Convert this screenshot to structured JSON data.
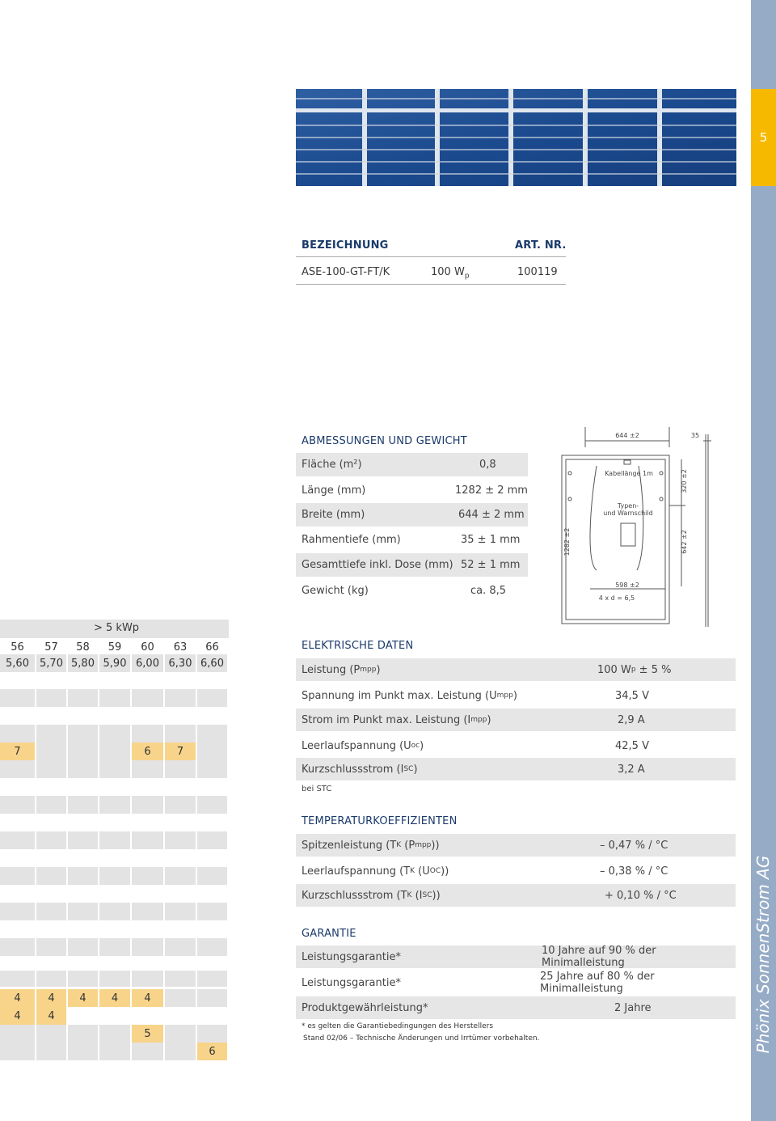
{
  "designation": {
    "header_label": "BEZEICHNUNG",
    "art_nr_label": "ART. NR.",
    "model": "ASE-100-GT-FT/K",
    "power_main": "100 W",
    "power_sub": "p",
    "art_nr": "100119"
  },
  "dimensions": {
    "title": "ABMESSUNGEN UND GEWICHT",
    "rows": [
      {
        "label": "Fläche (m²)",
        "value": "0,8"
      },
      {
        "label": "Länge (mm)",
        "value": "1282 ± 2 mm"
      },
      {
        "label": "Breite (mm)",
        "value": "644 ± 2 mm"
      },
      {
        "label": "Rahmentiefe (mm)",
        "value": "35 ± 1 mm"
      },
      {
        "label": "Gesamttiefe inkl. Dose (mm)",
        "value": "52 ± 1 mm"
      },
      {
        "label": "Gewicht (kg)",
        "value": "ca. 8,5"
      }
    ]
  },
  "drawing": {
    "width_label": "644 ±2",
    "depth_label": "35",
    "cable_label": "Kabellänge 1m",
    "typen_line1": "Typen-",
    "typen_line2": "und Warnschild",
    "height_label": "1282 ±2",
    "right_upper_label": "320 ±2",
    "right_lower_label": "642 ±2",
    "inner_width_label": "598 ±2",
    "holes_label": "4 x d = 6,5"
  },
  "left_table": {
    "header": "> 5 kWp",
    "row1": [
      "56",
      "57",
      "58",
      "59",
      "60",
      "63",
      "66"
    ],
    "row2": [
      "5,60",
      "5,70",
      "5,80",
      "5,90",
      "6,00",
      "6,30",
      "6,60"
    ],
    "yellow_row_a": [
      "7",
      "",
      "",
      "",
      "6",
      "7",
      ""
    ],
    "row_4a": [
      "4",
      "4",
      "4",
      "4",
      "4",
      "",
      ""
    ],
    "row_4b": [
      "4",
      "4",
      "",
      "",
      "",
      "",
      ""
    ],
    "row_5": [
      "",
      "",
      "",
      "",
      "5",
      "",
      ""
    ],
    "row_6": [
      "",
      "",
      "",
      "",
      "",
      "",
      "6"
    ]
  },
  "electrical": {
    "title": "ELEKTRISCHE DATEN",
    "rows": [
      {
        "label": "Leistung (P",
        "sub": "mpp",
        "end": ")",
        "value": "100 W",
        "vsub": "p",
        "vend": " ± 5 %"
      },
      {
        "label": "Spannung im Punkt max. Leistung (U",
        "sub": "mpp",
        "end": ")",
        "value": "34,5 V",
        "vsub": "",
        "vend": ""
      },
      {
        "label": "Strom im Punkt max. Leistung (I",
        "sub": "mpp",
        "end": ")",
        "value": "2,9 A",
        "vsub": "",
        "vend": ""
      },
      {
        "label": "Leerlaufspannung (U",
        "sub": "oc",
        "end": ")",
        "value": "42,5 V",
        "vsub": "",
        "vend": ""
      },
      {
        "label": "Kurzschlussstrom (I",
        "sub": "SC",
        "end": ")",
        "value": "3,2 A",
        "vsub": "",
        "vend": ""
      }
    ],
    "note": "bei STC"
  },
  "temperature": {
    "title": "TEMPERATURKOEFFIZIENTEN",
    "rows": [
      {
        "label": "Spitzenleistung (T",
        "sub1": "K",
        "mid": " (P",
        "sub2": "mpp",
        "end": "))",
        "value": "– 0,47 % / °C"
      },
      {
        "label": "Leerlaufspannung (T",
        "sub1": "K",
        "mid": " (U",
        "sub2": "OC",
        "end": "))",
        "value": "– 0,38 % / °C"
      },
      {
        "label": "Kurzschlussstrom (T",
        "sub1": "K",
        "mid": " (I",
        "sub2": "SC",
        "end": "))",
        "value": "+ 0,10 % / °C"
      }
    ]
  },
  "warranty": {
    "title": "GARANTIE",
    "rows": [
      {
        "label": "Leistungsgarantie*",
        "value": "10 Jahre auf 90 % der Minimalleistung"
      },
      {
        "label": "Leistungsgarantie*",
        "value": "25 Jahre auf 80 % der Minimalleistung"
      },
      {
        "label": "Produktgewährleistung*",
        "value": "2 Jahre"
      }
    ],
    "footnote1": "* es gelten die Garantiebedingungen des Herstellers",
    "footnote2": "Stand 02/06 – Technische Änderungen und Irrtümer vorbehalten."
  },
  "sidebar": {
    "tab_number": "5",
    "brand": "Phönix SonnenStrom AG"
  },
  "colors": {
    "navy": "#1b3a6b",
    "sidebar_blue": "#96abc6",
    "tab_yellow": "#f7b800",
    "cell_yellow": "#f7d48a",
    "row_gray": "#e6e6e6"
  }
}
